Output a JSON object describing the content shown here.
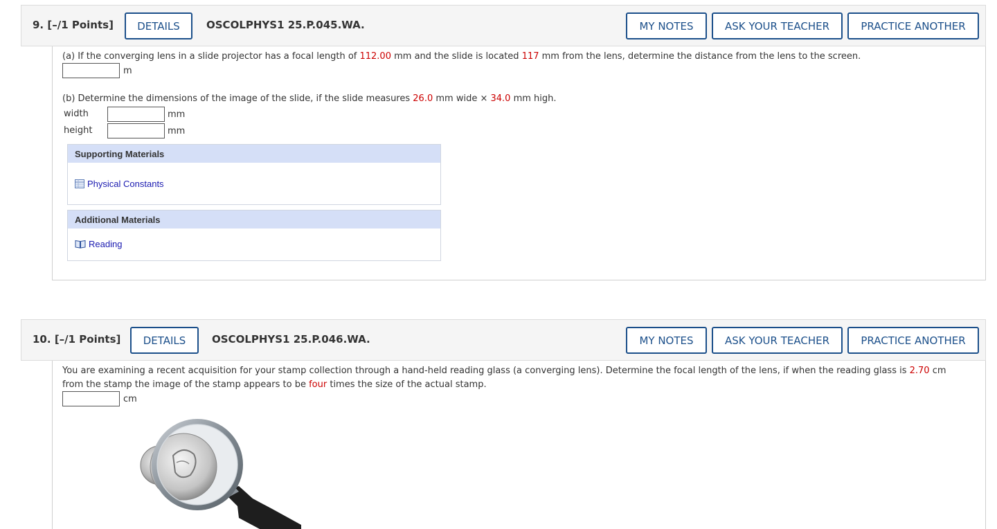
{
  "questions": [
    {
      "number": "9.",
      "points": "[–/1 Points]",
      "details_label": "DETAILS",
      "code": "OSCOLPHYS1 25.P.045.WA.",
      "my_notes_label": "MY NOTES",
      "ask_teacher_label": "ASK YOUR TEACHER",
      "practice_label": "PRACTICE ANOTHER",
      "part_a": {
        "t1": "(a) If the converging lens in a slide projector has a focal length of ",
        "v1": "112.00",
        "t2": " mm and the slide is located ",
        "v2": "117",
        "t3": " mm from the lens, determine the distance from the lens to the screen.",
        "unit": "m"
      },
      "part_b": {
        "t1": "(b) Determine the dimensions of the image of the slide, if the slide measures ",
        "v1": "26.0",
        "t2": " mm wide × ",
        "v2": "34.0",
        "t3": " mm high.",
        "width_label": "width",
        "height_label": "height",
        "unit": "mm"
      },
      "supporting": {
        "title": "Supporting Materials",
        "link": "Physical Constants"
      },
      "additional": {
        "title": "Additional Materials",
        "link": "Reading"
      }
    },
    {
      "number": "10.",
      "points": "[–/1 Points]",
      "details_label": "DETAILS",
      "code": "OSCOLPHYS1 25.P.046.WA.",
      "my_notes_label": "MY NOTES",
      "ask_teacher_label": "ASK YOUR TEACHER",
      "practice_label": "PRACTICE ANOTHER",
      "text": {
        "t1": "You are examining a recent acquisition for your stamp collection through a hand-held reading glass (a converging lens). Determine the focal length of the lens, if when the reading glass is ",
        "v1": "2.70",
        "t2": " cm",
        "t3": "from the stamp the image of the stamp appears to be ",
        "v2": "four",
        "t4": " times the size of the actual stamp.",
        "unit": "cm"
      }
    }
  ],
  "colors": {
    "accent": "#1b4f8a",
    "given_value": "#cc0000",
    "materials_header": "#d5dff7",
    "link": "#1a1ab0"
  }
}
